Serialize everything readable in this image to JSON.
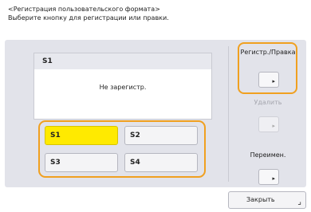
{
  "header": {
    "line1": "<Регистрация пользовательского формата>",
    "line2": "Выберите кнопку для регистрации или правки."
  },
  "card": {
    "title": "S1",
    "status": "Не зарегистр."
  },
  "slots": [
    {
      "label": "S1",
      "selected": true
    },
    {
      "label": "S2",
      "selected": false
    },
    {
      "label": "S3",
      "selected": false
    },
    {
      "label": "S4",
      "selected": false
    }
  ],
  "side": {
    "register_label": "Регистр./Правка",
    "delete_label": "Удалить",
    "rename_label": "Переимен.",
    "arrow": "▸"
  },
  "close": {
    "label": "Закрыть",
    "corner": "⌟"
  },
  "colors": {
    "accent_frame": "#f0a020",
    "selected_slot": "#ffea00"
  }
}
